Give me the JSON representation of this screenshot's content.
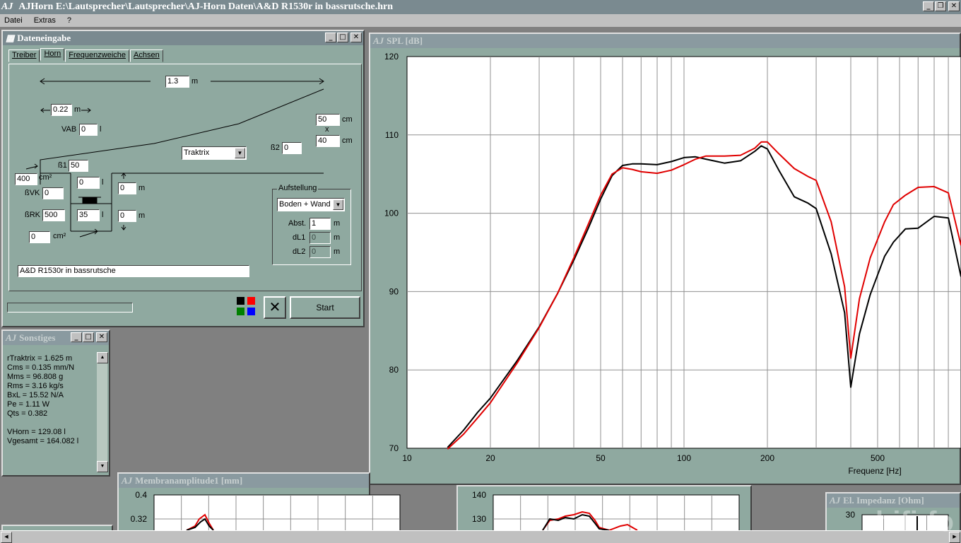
{
  "app": {
    "logo": "AJ",
    "title": "AJHorn  E:\\Lautsprecher\\Lautsprecher\\AJ-Horn Daten\\A&D R1530r in bassrutsche.hrn"
  },
  "menu": [
    "Datei",
    "Extras",
    "?"
  ],
  "dateneingabe": {
    "title": "Dateneingabe",
    "tabs": [
      "Treiber",
      "Horn",
      "Frequenzweiche",
      "Achsen"
    ],
    "active_tab": "Horn",
    "length": "1.3",
    "length_unit": "m",
    "small_len": "0.22",
    "small_len_unit": "m",
    "vab_label": "VAB",
    "vab": "0",
    "vab_unit": "l",
    "width": "50",
    "width_unit": "cm",
    "x_label": "x",
    "height": "40",
    "height_unit": "cm",
    "beta2_label": "ß2",
    "beta2": "0",
    "profile": "Traktrix",
    "beta1_label": "ß1",
    "beta1": "50",
    "area_in": "400",
    "area_in_unit": "cm²",
    "bvk_label": "ßVK",
    "bvk": "0",
    "vk": "0",
    "vk_unit": "l",
    "brk_label": "ßRK",
    "brk": "500",
    "rk": "35",
    "rk_unit": "l",
    "off_top": "0",
    "off_top_unit": "m",
    "off_bottom": "0",
    "off_bottom_unit": "m",
    "area_out": "0",
    "area_out_unit": "cm²",
    "aufstellung_title": "Aufstellung",
    "placement": "Boden + Wand",
    "abst_label": "Abst.",
    "abst": "1",
    "abst_unit": "m",
    "dl1_label": "dL1",
    "dl1": "0",
    "dl1_unit": "m",
    "dl2_label": "dL2",
    "dl2": "0",
    "dl2_unit": "m",
    "name": "A&D R1530r in bassrutsche",
    "cancel_icon": "✕",
    "start_label": "Start",
    "colors": [
      "#000000",
      "#ff0000",
      "#008000",
      "#0000ff"
    ]
  },
  "sonstiges": {
    "title": "Sonstiges",
    "lines": [
      "rTraktrix = 1.625 m",
      "Cms = 0.135 mm/N",
      "Mms = 96.808 g",
      "Rms = 3.16 kg/s",
      "BxL = 15.52 N/A",
      "Pe = 1.11 W",
      "Qts = 0.382",
      "",
      "VHorn = 129.08 l",
      "Vgesamt = 164.082 l"
    ]
  },
  "spl_title": "SPL [dB]",
  "membran_title": "Membranamplitude1 [mm]",
  "impedanz_title": "El. Impedanz [Ohm]",
  "watermark": "hifi-fo",
  "chart_data": [
    {
      "type": "line",
      "title": "SPL [dB]",
      "xlabel": "Frequenz [Hz]",
      "ylabel": "",
      "xscale": "log",
      "xlim": [
        10,
        1000
      ],
      "ylim": [
        70,
        120
      ],
      "xticks": [
        10,
        20,
        50,
        100,
        200,
        500
      ],
      "xtick_labels": [
        "10",
        "20",
        "50",
        "100",
        "200",
        "500"
      ],
      "yticks": [
        70,
        80,
        90,
        100,
        110,
        120
      ],
      "grid": true,
      "series": [
        {
          "color": "#000000",
          "x": [
            14,
            16,
            18,
            20,
            25,
            30,
            35,
            40,
            45,
            50,
            55,
            60,
            65,
            70,
            80,
            90,
            100,
            110,
            120,
            140,
            160,
            180,
            190,
            200,
            220,
            250,
            280,
            300,
            340,
            380,
            400,
            430,
            470,
            530,
            570,
            630,
            700,
            800,
            900,
            1000
          ],
          "y": [
            70.1,
            72.3,
            74.6,
            76.4,
            81.2,
            85.5,
            89.8,
            94,
            98,
            101.8,
            104.8,
            106.1,
            106.3,
            106.3,
            106.2,
            106.6,
            107.1,
            107.2,
            106.9,
            106.4,
            106.7,
            107.9,
            108.6,
            108.2,
            105.5,
            102.1,
            101.3,
            100.6,
            94.8,
            87.3,
            77.8,
            84.6,
            89.6,
            94.5,
            96.3,
            98,
            98.1,
            99.6,
            99.4,
            91.9
          ]
        },
        {
          "color": "#e00000",
          "x": [
            14,
            16,
            18,
            20,
            25,
            30,
            35,
            40,
            45,
            50,
            55,
            60,
            65,
            70,
            80,
            90,
            100,
            110,
            120,
            140,
            160,
            180,
            190,
            200,
            220,
            250,
            280,
            300,
            340,
            380,
            400,
            430,
            470,
            530,
            570,
            630,
            700,
            800,
            900,
            1000
          ],
          "y": [
            69.9,
            71.8,
            73.9,
            75.8,
            80.9,
            85.4,
            89.8,
            94.3,
            98.5,
            102.3,
            105,
            105.8,
            105.6,
            105.3,
            105.1,
            105.5,
            106.2,
            106.9,
            107.3,
            107.3,
            107.4,
            108.3,
            109.1,
            109.1,
            107.6,
            105.7,
            104.7,
            104.2,
            98.9,
            90.6,
            81.5,
            89.1,
            94.3,
            98.9,
            101.1,
            102.3,
            103.3,
            103.4,
            102.6,
            95.9
          ]
        }
      ]
    },
    {
      "type": "line",
      "title": "Membranamplitude1 [mm]",
      "xlabel": "",
      "ylabel": "",
      "ylim": [
        0.24,
        0.4
      ],
      "yticks": [
        0.4,
        0.32
      ],
      "grid": true,
      "series": []
    },
    {
      "type": "line",
      "title": "",
      "xlabel": "",
      "ylabel": "",
      "ylim": [
        120,
        140
      ],
      "yticks": [
        140,
        130
      ],
      "grid": true,
      "series": []
    },
    {
      "type": "line",
      "title": "El. Impedanz [Ohm]",
      "xlabel": "",
      "ylabel": "",
      "ylim": [
        0,
        30
      ],
      "yticks": [
        30
      ],
      "grid": true,
      "series": []
    }
  ]
}
